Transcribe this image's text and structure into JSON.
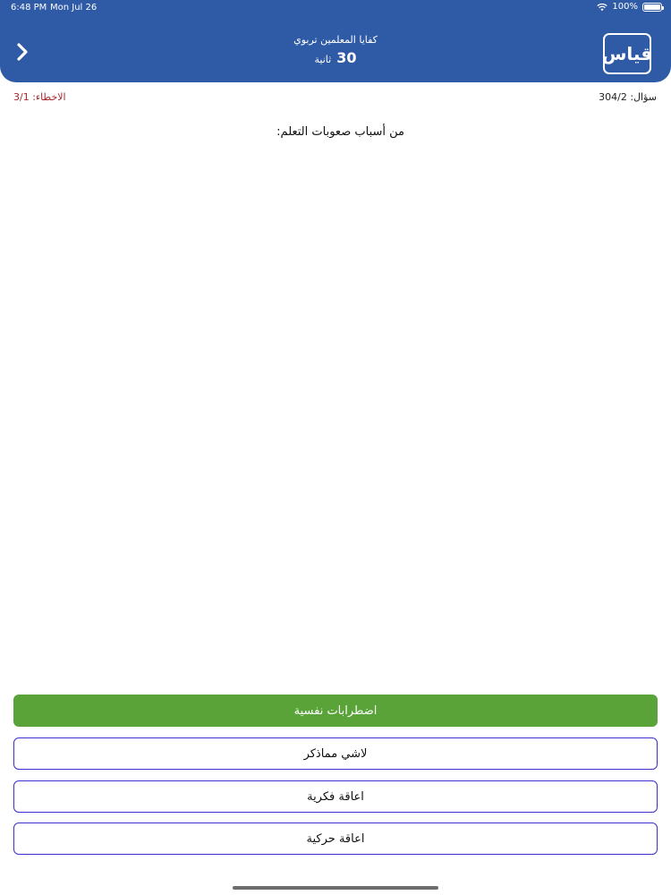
{
  "status_bar": {
    "time": "6:48 PM",
    "date": "Mon Jul 26",
    "battery": "100%"
  },
  "header": {
    "title": "كفايا المعلمين تربوي",
    "timer_value": "30",
    "timer_unit": "ثانية",
    "logo_text": "قياس"
  },
  "meta": {
    "errors": "الاخطاء: 3/1",
    "question_counter": "سؤال: 304/2"
  },
  "question": {
    "text": "من أسباب صعوبات التعلم:"
  },
  "answers": [
    {
      "label": "اضطرابات نفسية",
      "state": "correct"
    },
    {
      "label": "لاشي مماذكر",
      "state": "normal"
    },
    {
      "label": "اعاقة فكرية",
      "state": "normal"
    },
    {
      "label": "اعاقة حركية",
      "state": "normal"
    }
  ],
  "colors": {
    "header_bg": "#2f5aa6",
    "correct_bg": "#59a338",
    "answer_border": "#3d2fd0",
    "error_text": "#a4272b"
  }
}
